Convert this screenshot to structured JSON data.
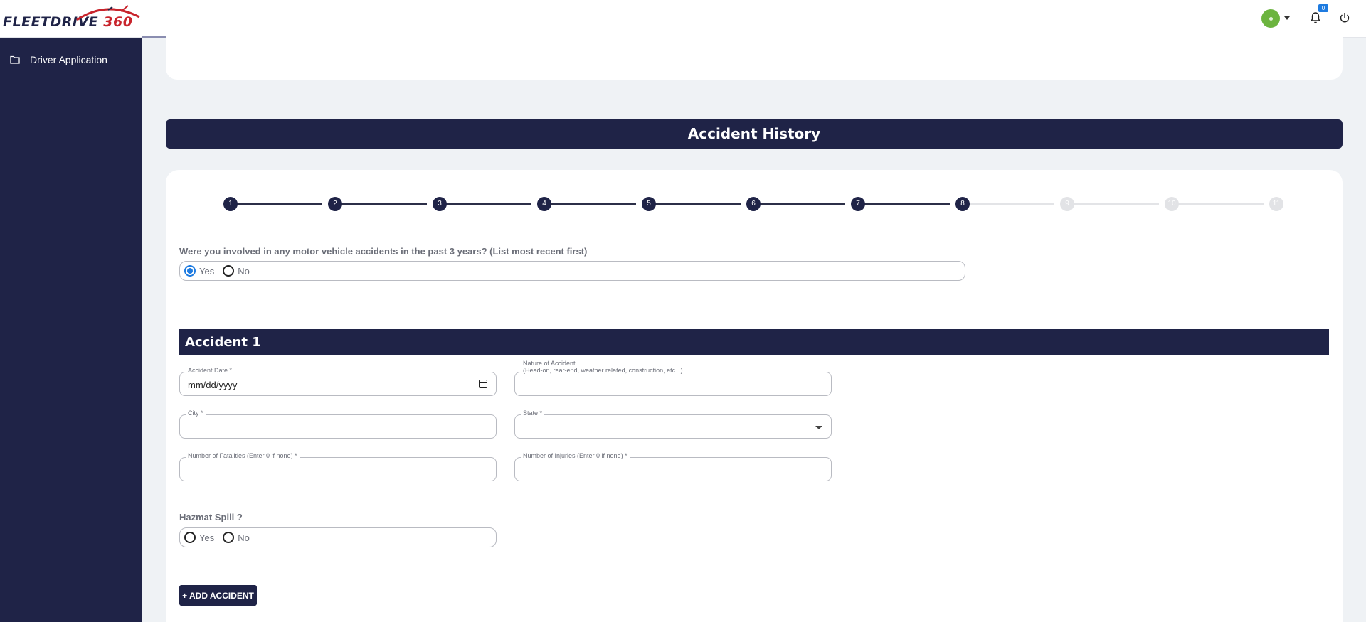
{
  "header": {
    "logo_text": "FLEETDRIVE",
    "logo_number": "360",
    "notification_count": "0",
    "colors": {
      "brand": "#1f2347",
      "logo_accent": "#c8242c",
      "status_online": "#6cb43f",
      "badge": "#1e7be0"
    }
  },
  "sidebar": {
    "items": [
      {
        "label": "Driver Application",
        "icon": "folder-icon"
      }
    ]
  },
  "section": {
    "title": "Accident History"
  },
  "stepper": {
    "steps": [
      "1",
      "2",
      "3",
      "4",
      "5",
      "6",
      "7",
      "8",
      "9",
      "10",
      "11"
    ],
    "current_step": 8
  },
  "question": {
    "text": "Were you involved in any motor vehicle accidents in the past 3 years? (List most recent first)",
    "options": [
      "Yes",
      "No"
    ],
    "selected": "Yes"
  },
  "accident": {
    "title": "Accident 1",
    "fields": {
      "accident_date": {
        "label": "Accident Date *",
        "value": "mm/dd/yyyy"
      },
      "nature": {
        "label_line1": "Nature of Accident",
        "label_line2": "(Head-on, rear-end, weather related, construction, etc...)",
        "value": ""
      },
      "city": {
        "label": "City *",
        "value": ""
      },
      "state": {
        "label": "State *",
        "value": ""
      },
      "fatalities": {
        "label": "Number of Fatalities (Enter 0 if none) *",
        "value": ""
      },
      "injuries": {
        "label": "Number of Injuries (Enter 0 if none) *",
        "value": ""
      }
    },
    "hazmat": {
      "label": "Hazmat Spill ?",
      "options": [
        "Yes",
        "No"
      ],
      "selected": ""
    }
  },
  "actions": {
    "add_accident_label": "+ ADD ACCIDENT"
  }
}
